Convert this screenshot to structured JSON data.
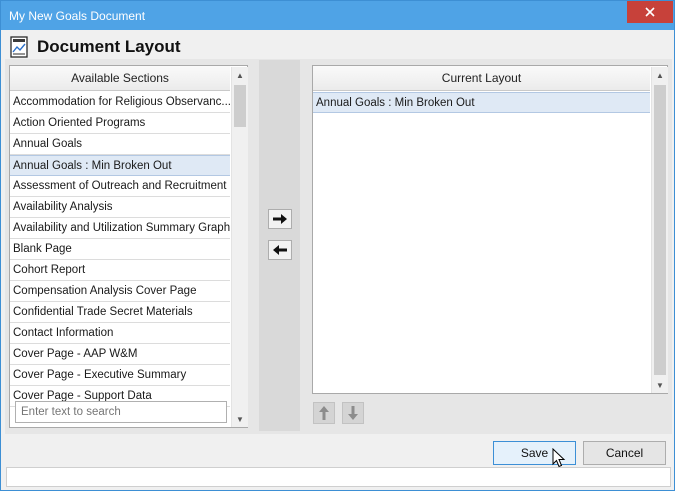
{
  "window": {
    "title": "My New Goals Document"
  },
  "header": {
    "title": "Document Layout",
    "icon": "document-chart-icon"
  },
  "available": {
    "header": "Available Sections",
    "items": [
      "Accommodation for Religious Observanc...",
      "Action Oriented Programs",
      "Annual Goals",
      "Annual Goals : Min Broken Out",
      "Assessment of Outreach and Recruitment",
      "Availability Analysis",
      "Availability and Utilization Summary Graph",
      "Blank Page",
      "Cohort Report",
      "Compensation Analysis Cover Page",
      "Confidential Trade Secret Materials",
      "Contact Information",
      "Cover Page - AAP W&M",
      "Cover Page - Executive Summary",
      "Cover Page - Support Data"
    ],
    "selected_index": 3,
    "search_placeholder": "Enter text to search"
  },
  "current": {
    "header": "Current Layout",
    "items": [
      "Annual Goals : Min Broken Out"
    ]
  },
  "buttons": {
    "add": "right-arrow-icon",
    "remove": "left-arrow-icon",
    "move_up": "up-arrow-icon",
    "move_down": "down-arrow-icon",
    "save": "Save",
    "cancel": "Cancel"
  },
  "colors": {
    "titlebar": "#4fa3e6",
    "close_button": "#c7413a",
    "selection": "#dfe9f5",
    "primary_button_border": "#3c8fd6"
  }
}
